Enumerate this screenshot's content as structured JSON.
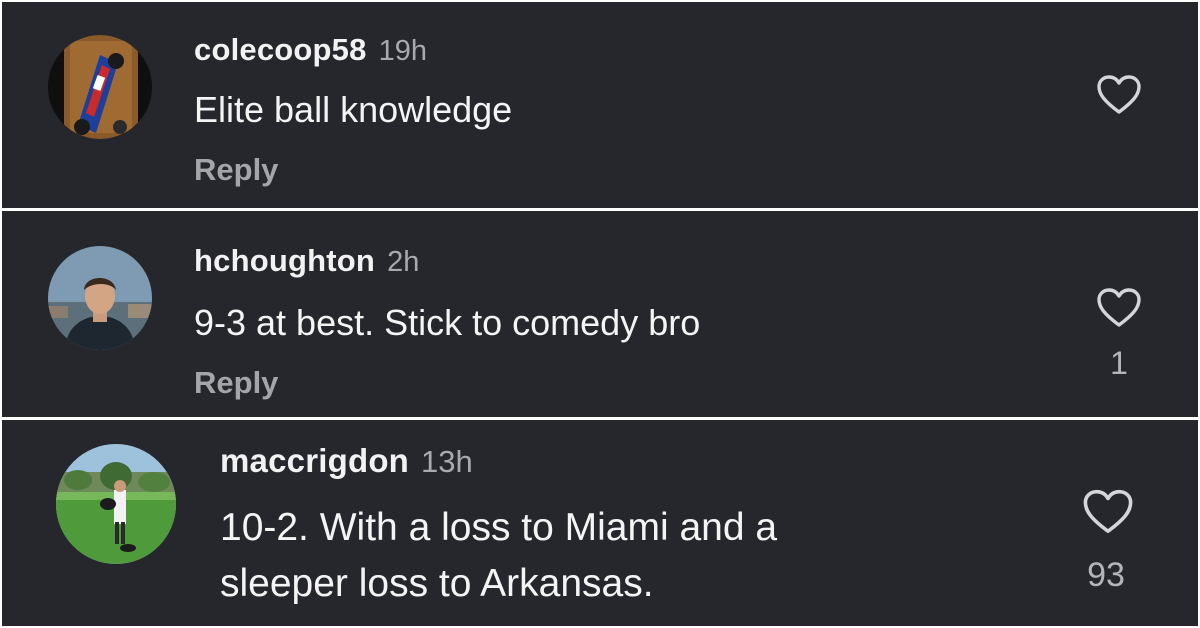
{
  "comments": [
    {
      "username": "colecoop58",
      "time": "19h",
      "text": "Elite ball knowledge",
      "reply_label": "Reply",
      "likes": "",
      "avatar": "race-car-avatar"
    },
    {
      "username": "hchoughton",
      "time": "2h",
      "text": "9-3 at best. Stick to comedy bro",
      "reply_label": "Reply",
      "likes": "1",
      "avatar": "person-avatar"
    },
    {
      "username": "maccrigdon",
      "time": "13h",
      "text_lines": [
        "10-2. With a loss to Miami and a",
        "sleeper loss to Arkansas."
      ],
      "likes": "93",
      "avatar": "field-avatar"
    }
  ],
  "colors": {
    "background": "#25272d",
    "username": "#f2f2f2",
    "secondary": "#a8a9ad",
    "heart": "#d4d5d8"
  },
  "icons": [
    "heart-icon"
  ]
}
